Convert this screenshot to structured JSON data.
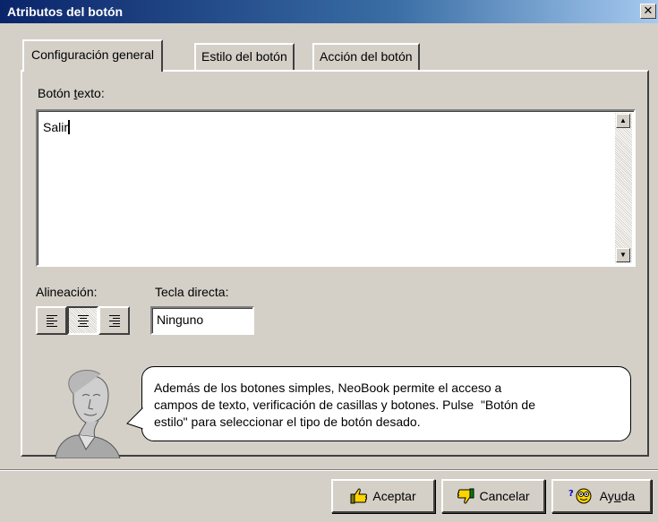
{
  "window": {
    "title": "Atributos del botón",
    "close_glyph": "✕"
  },
  "tabs": [
    {
      "label": "Configuración general",
      "active": true
    },
    {
      "label": "Estilo del botón",
      "active": false
    },
    {
      "label": "Acción del botón",
      "active": false
    }
  ],
  "button_text": {
    "label_pre": "Botón ",
    "label_mnemonic": "t",
    "label_post": "exto:",
    "value": "Salir"
  },
  "alignment": {
    "label": "Alineación:",
    "options": [
      "left",
      "center",
      "right"
    ],
    "selected": "center"
  },
  "hotkey": {
    "label": "Tecla directa:",
    "value": "Ninguno"
  },
  "help_bubble": {
    "lines": [
      "Además de los botones simples, NeoBook permite el acceso a",
      "campos de texto, verificación de casillas y botones. Pulse  \"Botón de",
      "estilo\" para seleccionar el tipo de botón desado."
    ]
  },
  "buttons": {
    "accept": {
      "label": "Aceptar",
      "icon": "thumbs-up-icon"
    },
    "cancel": {
      "label": "Cancelar",
      "icon": "thumbs-down-icon"
    },
    "help": {
      "label_pre": "Ay",
      "label_mnemonic": "u",
      "label_post": "da",
      "icon": "help-smiley-icon"
    }
  },
  "colors": {
    "title_start": "#0a246a",
    "title_end": "#a6caf0",
    "face": "#d4d0c8"
  }
}
